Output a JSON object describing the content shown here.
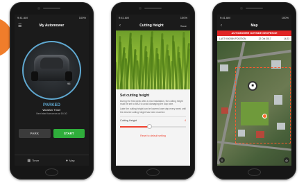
{
  "phones": [
    {
      "statusbar": {
        "time": "9:41 AM",
        "battery": "100%"
      },
      "nav": {
        "menu_icon": "hamburger-menu-icon",
        "title": "My Automower"
      },
      "mower": {
        "battery_label": "96"
      },
      "status": {
        "main": "PARKED",
        "sub": "Weather Timer",
        "next": "Next start tomorrow at 16.30"
      },
      "actions": {
        "park_label": "PARK",
        "start_label": "START"
      },
      "tabs": [
        {
          "icon": "calendar-icon",
          "label": "Timer"
        },
        {
          "icon": "location-pin-icon",
          "label": "Map"
        }
      ],
      "colors": {
        "accent": "#5fa8d0",
        "start_green": "#2fae3b"
      }
    },
    {
      "statusbar": {
        "time": "9:41 AM",
        "battery": "100%"
      },
      "nav": {
        "back_icon": "chevron-left-icon",
        "title": "Cutting Height",
        "right_label": "Save"
      },
      "panel": {
        "title": "Set cutting height",
        "text1": "During the first week after a new installation, the cutting height must be set to MAX to avoid damaging the loop wire.",
        "text2": "Later the cutting height can be lowered one step every week until the desired cutting height has been reached.",
        "field_label": "Cutting Height",
        "field_value": "4",
        "slider_level": 0.45,
        "reset_label": "Reset to default setting"
      },
      "colors": {
        "accent": "#f0412f"
      }
    },
    {
      "statusbar": {
        "time": "9:41 AM",
        "battery": "100%"
      },
      "nav": {
        "back_icon": "chevron-left-icon",
        "title": "Map"
      },
      "alert": "AUTOMOWER OUTSIDE GEOFENCE",
      "position": {
        "label": "LAST KNOWN POSITION",
        "date": "22 Oct 2017",
        "time": "14:23"
      },
      "colors": {
        "alert": "#e02525",
        "fence": "#ff5a2e"
      }
    }
  ]
}
